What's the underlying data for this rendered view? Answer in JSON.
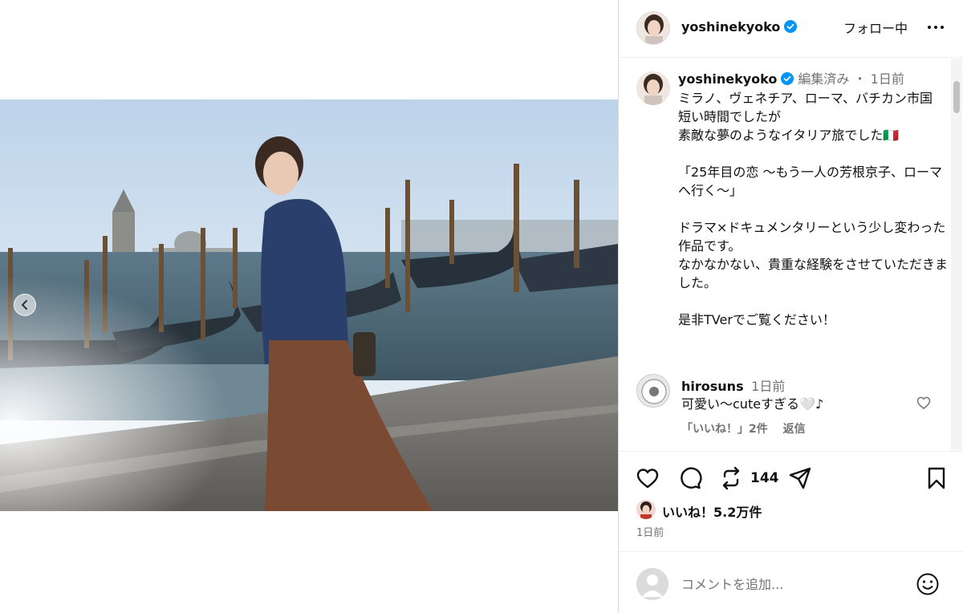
{
  "post": {
    "username": "yoshinekyoko",
    "follow_status": "フォロー中",
    "more_icon": "more-horizontal-icon"
  },
  "caption": {
    "username": "yoshinekyoko",
    "edited": "編集済み",
    "separator": "・",
    "time": "1日前",
    "text": "ミラノ、ヴェネチア、ローマ、バチカン市国\n短い時間でしたが\n素敵な夢のようなイタリア旅でした🇮🇹\n\n「25年目の恋 〜もう一人の芳根京子、ローマへ行く〜」\n\nドラマ×ドキュメンタリーという少し変わった作品です。\nなかなかない、貴重な経験をさせていただきました。\n\n是非TVerでご覧ください！"
  },
  "comments": [
    {
      "username": "hirosuns",
      "time": "1日前",
      "text": "可愛い〜cuteすぎる🤍♪",
      "likes": "「いいね！」2件",
      "reply": "返信"
    }
  ],
  "actions": {
    "repost_count": "144",
    "likes": "いいね！5.2万件",
    "time": "1日前"
  },
  "add_comment": {
    "placeholder": "コメントを追加..."
  },
  "colors": {
    "verified": "#0095f6",
    "text_secondary": "#737373",
    "border": "#dbdbdb"
  },
  "icons": [
    "heart-icon",
    "comment-icon",
    "repost-icon",
    "share-icon",
    "bookmark-icon",
    "emoji-icon",
    "verified-badge-icon",
    "chevron-left-icon"
  ]
}
